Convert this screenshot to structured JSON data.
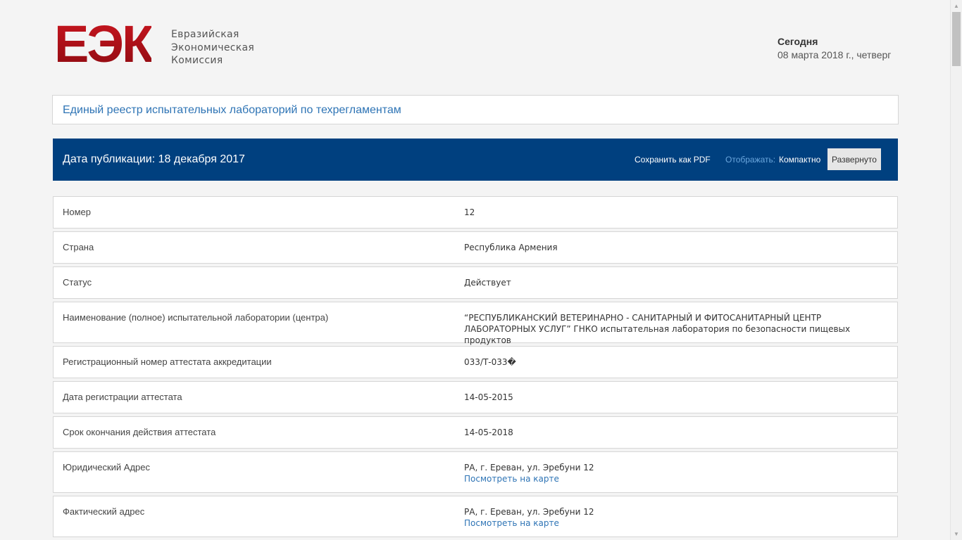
{
  "logo": {
    "mark": "ЕЭК",
    "line1": "Евразийская",
    "line2": "Экономическая",
    "line3": "Комиссия"
  },
  "today": {
    "label": "Сегодня",
    "date": "08 марта 2018 г., четверг"
  },
  "registry_title": "Единый реестр испытательных лабораторий по техрегламентам",
  "toolbar": {
    "pub_date": "Дата публикации: 18 декабря 2017",
    "save_pdf": "Сохранить как PDF",
    "display_label": "Отображать:",
    "compact": "Компактно",
    "expanded": "Развернуто"
  },
  "rows": [
    {
      "label": "Номер",
      "value": "12"
    },
    {
      "label": "Страна",
      "value": "Республика Армения"
    },
    {
      "label": "Статус",
      "value": "Действует"
    },
    {
      "label": "Наименование (полное) испытательной лаборатории (центра)",
      "value": "“РЕСПУБЛИКАНСКИЙ ВЕТЕРИНАРНО - САНИТАРНЫЙ И ФИТОСАНИТАРНЫЙ ЦЕНТР ЛАБОРАТОРНЫХ УСЛУГ” ГНКО испытательная лаборатория по безопасности пищевых продуктов"
    },
    {
      "label": "Регистрационный номер аттестата аккредитации",
      "value": "033/Т-033�"
    },
    {
      "label": "Дата регистрации аттестата",
      "value": "14-05-2015"
    },
    {
      "label": "Срок окончания действия аттестата",
      "value": "14-05-2018"
    },
    {
      "label": "Юридический Адрес",
      "value": "РА, г. Ереван, ул. Эребуни 12",
      "link": "Посмотреть на карте"
    },
    {
      "label": "Фактический адрес",
      "value": "РА, г. Ереван, ул. Эребуни 12",
      "link": "Посмотреть на карте"
    }
  ],
  "colors": {
    "brand_red": "#a30f17",
    "bar_blue": "#00407f",
    "link_blue": "#2e74b5"
  }
}
